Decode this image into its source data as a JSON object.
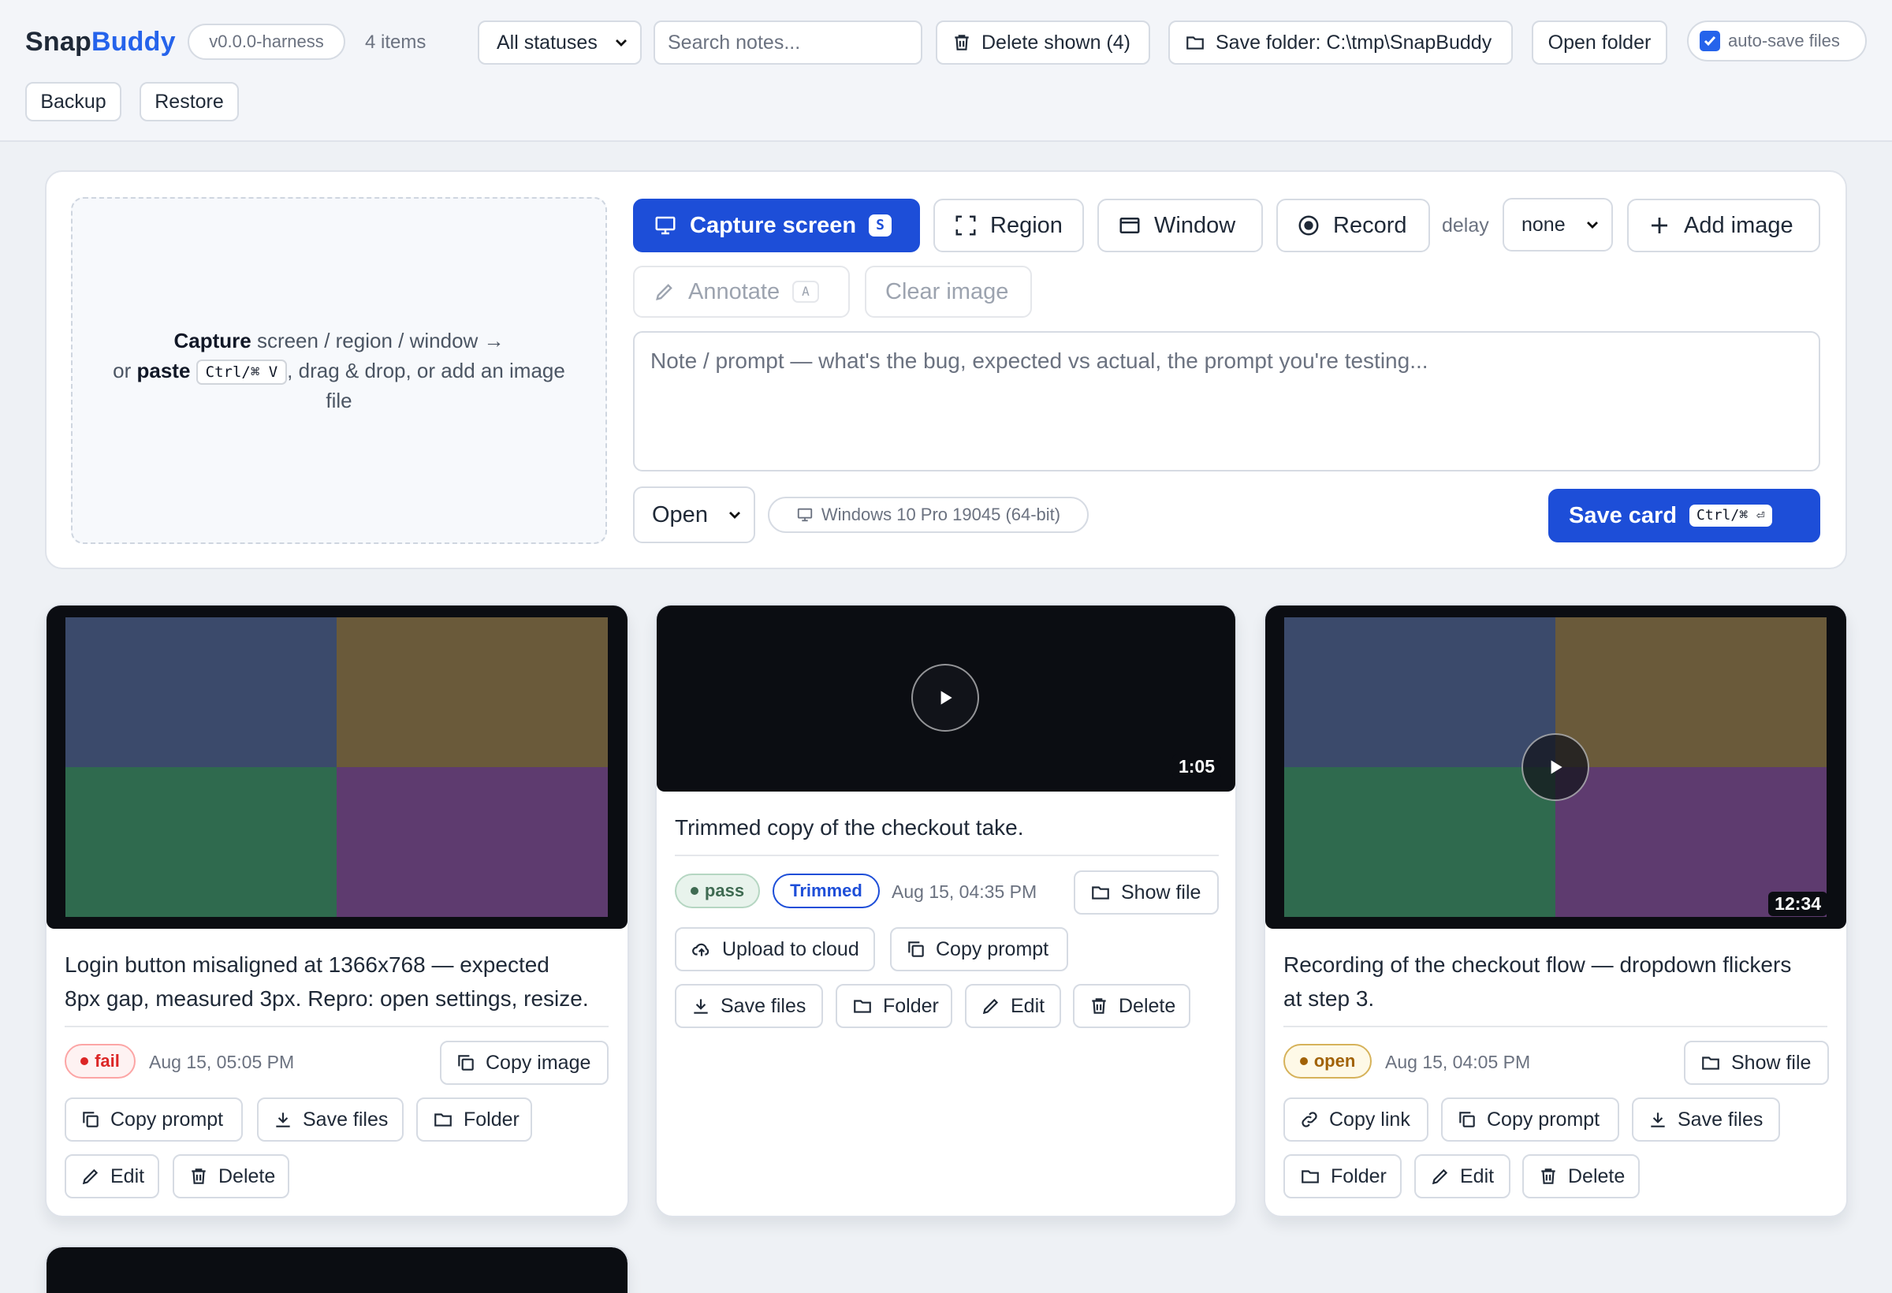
{
  "header": {
    "logo_a": "Snap",
    "logo_b": "Buddy",
    "version": "v0.0.0-harness",
    "item_count": "4 items",
    "status_filter": "All statuses",
    "search_placeholder": "Search notes...",
    "delete_shown": "Delete shown (4)",
    "save_folder": "Save folder: C:\\tmp\\SnapBuddy",
    "open_folder": "Open folder",
    "autosave_label": "auto-save files",
    "backup": "Backup",
    "restore": "Restore"
  },
  "capture": {
    "drop_line1_strong": "Capture",
    "drop_line1_rest": " screen / region / window →",
    "drop_line2_pre": "or ",
    "drop_line2_strong": "paste",
    "drop_kbd": "Ctrl/⌘ V",
    "drop_line2_rest": ", drag & drop, or add an image",
    "drop_line3": "file",
    "capture_screen": "Capture screen",
    "capture_screen_key": "S",
    "region": "Region",
    "window": "Window",
    "record": "Record",
    "delay_label": "delay",
    "delay_value": "none",
    "add_image": "Add image",
    "annotate": "Annotate",
    "annotate_key": "A",
    "clear_image": "Clear image",
    "note_placeholder": "Note / prompt — what's the bug, expected vs actual, the prompt you're testing...",
    "status_value": "Open",
    "os_info": "Windows 10 Pro 19045 (64-bit)",
    "save_card": "Save card",
    "save_card_kbd": "Ctrl/⌘ ⏎"
  },
  "cards": [
    {
      "note_line1": "Login button misaligned at 1366x768 — expected",
      "note_line2": "8px gap, measured 3px. Repro: open settings, resize.",
      "status": "fail",
      "date": "Aug 15, 05:05 PM",
      "copy_image": "Copy image",
      "copy_prompt": "Copy prompt",
      "save_files": "Save files",
      "folder": "Folder",
      "edit": "Edit",
      "delete": "Delete"
    },
    {
      "duration": "1:05",
      "note_line1": "Trimmed copy of the checkout take.",
      "status": "pass",
      "tag": "Trimmed",
      "date": "Aug 15, 04:35 PM",
      "show_file": "Show file",
      "upload": "Upload to cloud",
      "copy_prompt": "Copy prompt",
      "save_files": "Save files",
      "folder": "Folder",
      "edit": "Edit",
      "delete": "Delete"
    },
    {
      "duration": "12:34",
      "note_line1": "Recording of the checkout flow — dropdown flickers",
      "note_line2": "at step 3.",
      "status": "open",
      "date": "Aug 15, 04:05 PM",
      "show_file": "Show file",
      "copy_link": "Copy link",
      "copy_prompt": "Copy prompt",
      "save_files": "Save files",
      "folder": "Folder",
      "edit": "Edit",
      "delete": "Delete"
    }
  ],
  "colors": {
    "accent": "#1d4ed8",
    "fail": "#dc2626",
    "pass": "#15803d",
    "open": "#b45309"
  }
}
